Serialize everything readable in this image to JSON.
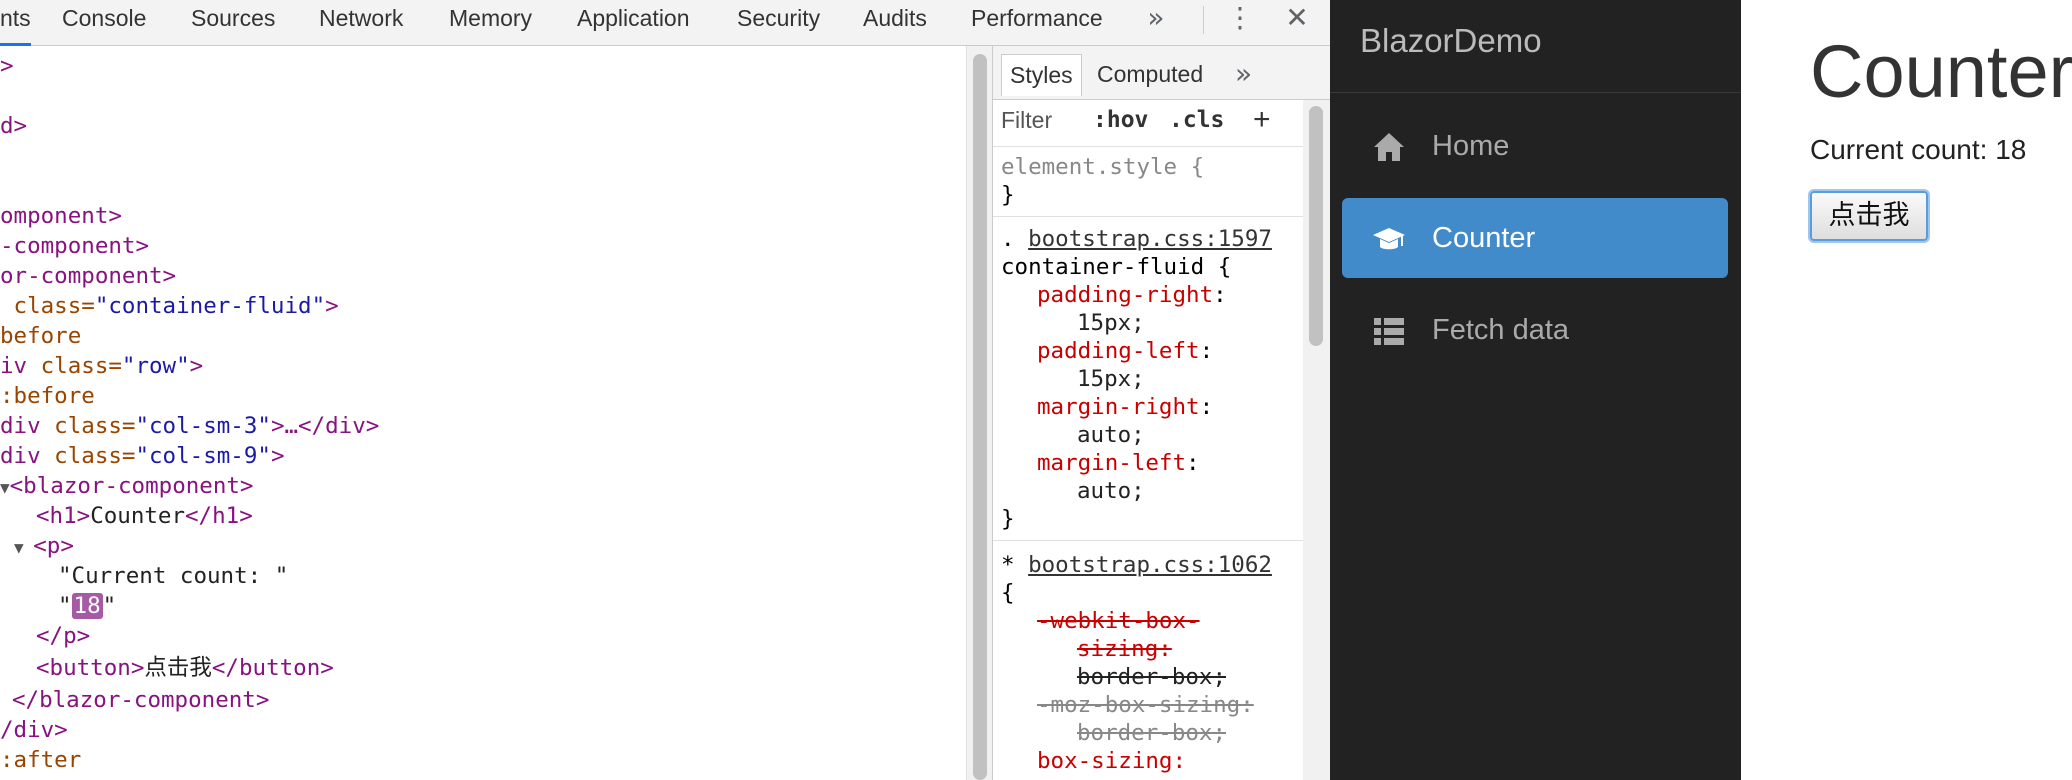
{
  "devtools": {
    "tabs": [
      {
        "label": "nts",
        "active": true
      },
      {
        "label": "Console"
      },
      {
        "label": "Sources"
      },
      {
        "label": "Network"
      },
      {
        "label": "Memory"
      },
      {
        "label": "Application"
      },
      {
        "label": "Security"
      },
      {
        "label": "Audits"
      },
      {
        "label": "Performance"
      }
    ],
    "more_tabs_icon": "»",
    "kebab_icon": "⋮",
    "close_icon": "✕",
    "elements": {
      "l1": ">",
      "l2": "d>",
      "l3_tag": "omponent>",
      "l4_tag": "-component>",
      "l5_tag": "or-component>",
      "l6_attr": " class=",
      "l6_val": "\"container-fluid\"",
      "l6_end": ">",
      "l7": "before",
      "l8_tag": "iv",
      "l8_attr": " class=",
      "l8_val": "\"row\"",
      "l8_end": ">",
      "l9": ":before",
      "l10_tag": "div",
      "l10_attr": " class=",
      "l10_val": "\"col-sm-3\"",
      "l10_end": ">…</div>",
      "l11_tag": "div",
      "l11_attr": " class=",
      "l11_val": "\"col-sm-9\"",
      "l11_end": ">",
      "l12_tag": "<blazor-component>",
      "l13_open": "<h1>",
      "l13_text": "Counter",
      "l13_close": "</h1>",
      "l14_tag": "<p>",
      "l15_text": "\"Current count: \"",
      "l16_q1": "\"",
      "l16_val": "18",
      "l16_q2": "\"",
      "l17_tag": "</p>",
      "l18_open": "<button>",
      "l18_text": "点击我",
      "l18_close": "</button>",
      "l19_tag": "</blazor-component>",
      "l20_tag": "/div>",
      "l21": ":after"
    },
    "styles": {
      "tabs": [
        "Styles",
        "Computed"
      ],
      "more_icon": "»",
      "filter_label": "Filter",
      "hov_label": ":hov",
      "cls_label": ".cls",
      "add_icon": "+",
      "r1_sel": "element.style {",
      "r1_end": "}",
      "r2_prefix": ". ",
      "r2_source": "bootstrap.css:1597",
      "r2_sel": "container-fluid {",
      "r2_p1": "padding-right",
      "r2_v1": "15px;",
      "r2_p2": "padding-left",
      "r2_v2": "15px;",
      "r2_p3": "margin-right",
      "r2_v3": "auto;",
      "r2_p4": "margin-left",
      "r2_v4": "auto;",
      "r2_end": "}",
      "r3_prefix": "* ",
      "r3_source": "bootstrap.css:1062",
      "r3_open": "{",
      "r3_p1a": "-webkit-box-",
      "r3_p1b": "sizing:",
      "r3_v1": "border-box;",
      "r3_p2": "-moz-box-sizing:",
      "r3_v2": "border-box;",
      "r3_p3": "box-sizing:"
    }
  },
  "app": {
    "brand": "BlazorDemo",
    "nav": [
      {
        "label": "Home",
        "icon": "home-icon"
      },
      {
        "label": "Counter",
        "icon": "graduation-cap-icon",
        "active": true
      },
      {
        "label": "Fetch data",
        "icon": "list-icon"
      }
    ],
    "page_title": "Counter",
    "count_label": "Current count: 18",
    "button_label": "点击我",
    "colors": {
      "sidebar_bg": "#222222",
      "active_nav": "#428bca"
    }
  }
}
